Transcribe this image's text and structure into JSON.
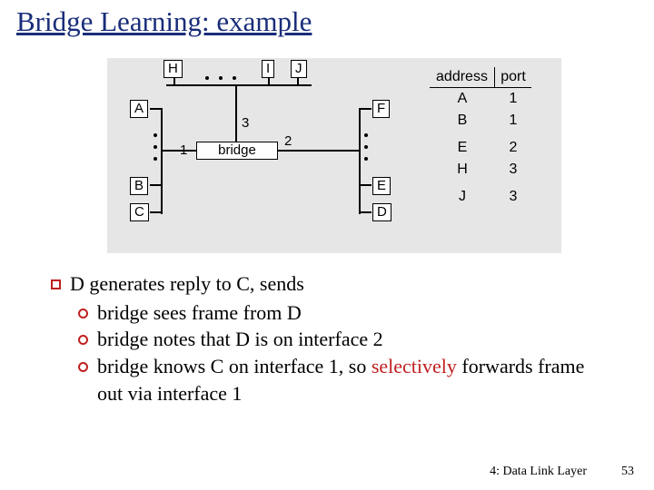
{
  "title": "Bridge Learning: example",
  "diagram": {
    "bridge_label": "bridge",
    "nodes": {
      "H": "H",
      "I": "I",
      "J": "J",
      "A": "A",
      "F": "F",
      "B": "B",
      "E": "E",
      "C": "C",
      "D": "D"
    },
    "ports": {
      "p1": "1",
      "p2": "2",
      "p3": "3"
    },
    "table": {
      "headers": {
        "addr": "address",
        "port": "port"
      },
      "rows": [
        {
          "addr": "A",
          "port": "1"
        },
        {
          "addr": "B",
          "port": "1"
        },
        {
          "addr": "E",
          "port": "2"
        },
        {
          "addr": "H",
          "port": "3"
        },
        {
          "addr": "J",
          "port": "3"
        }
      ]
    }
  },
  "bullets": {
    "main": "D generates reply to C, sends",
    "sub1": "bridge sees frame from D",
    "sub2": "bridge notes that D is on interface 2",
    "sub3_a": "bridge knows C on interface 1, so ",
    "sub3_b": "selectively",
    "sub3_c": " forwards frame out via interface 1"
  },
  "footer": {
    "chapter": "4: Data Link Layer",
    "page": "53"
  }
}
